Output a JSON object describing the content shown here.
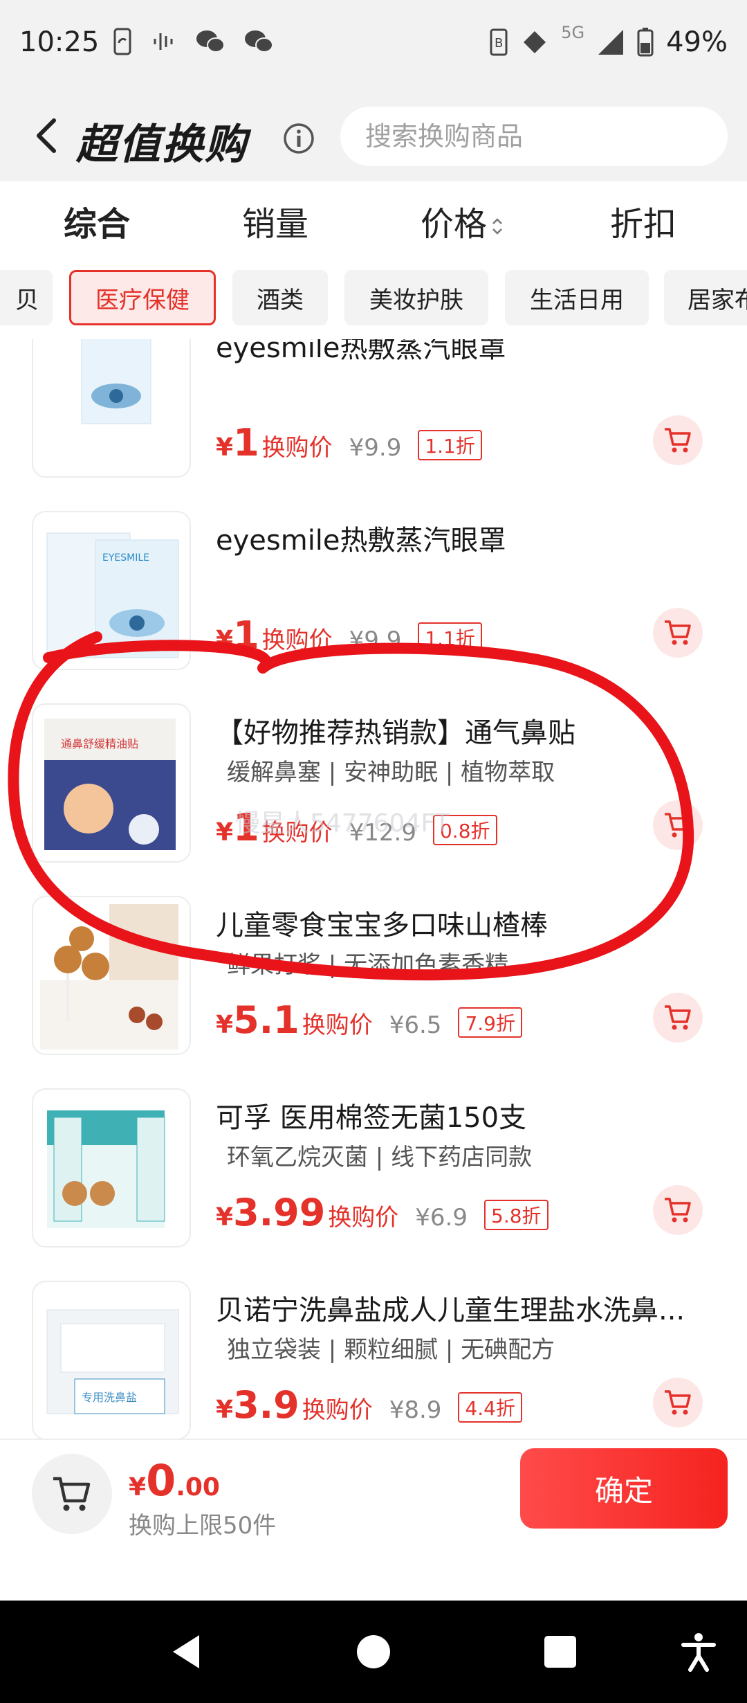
{
  "status_bar": {
    "time": "10:25",
    "network": "5G",
    "battery": "49%",
    "icons": [
      "phone-sync-icon",
      "voice-icon",
      "wechat-icon",
      "wechat-icon",
      "nfc-icon",
      "data-icon",
      "wifi-icon",
      "signal-icon",
      "battery-icon"
    ]
  },
  "header": {
    "title": "超值换购",
    "search_placeholder": "搜索换购商品"
  },
  "sort_tabs": [
    {
      "label": "综合",
      "active": true
    },
    {
      "label": "销量",
      "active": false
    },
    {
      "label": "价格",
      "active": false
    },
    {
      "label": "折扣",
      "active": false
    }
  ],
  "categories": [
    {
      "label": "贝",
      "active": false
    },
    {
      "label": "医疗保健",
      "active": true
    },
    {
      "label": "酒类",
      "active": false
    },
    {
      "label": "美妆护肤",
      "active": false
    },
    {
      "label": "生活日用",
      "active": false
    },
    {
      "label": "居家布",
      "active": false
    }
  ],
  "products": [
    {
      "title": "eyesmile热敷蒸汽眼罩",
      "tags": "",
      "price": "1",
      "price_label": "换购价",
      "original": "¥9.9",
      "discount": "1.1折"
    },
    {
      "title": "eyesmile热敷蒸汽眼罩",
      "tags": "",
      "price": "1",
      "price_label": "换购价",
      "original": "¥9.9",
      "discount": "1.1折"
    },
    {
      "title": "【好物推荐热销款】通气鼻贴",
      "tags": "缓解鼻塞 | 安神助眠 | 植物萃取",
      "price": "1",
      "price_label": "换购价",
      "original": "¥12.9",
      "discount": "0.8折"
    },
    {
      "title": "儿童零食宝宝多口味山楂棒",
      "tags": "鲜果打浆 | 无添加色素香精",
      "price": "5.1",
      "price_label": "换购价",
      "original": "¥6.5",
      "discount": "7.9折"
    },
    {
      "title": "可孚 医用棉签无菌150支",
      "tags": "环氧乙烷灭菌 | 线下药店同款",
      "price": "3.99",
      "price_label": "换购价",
      "original": "¥6.9",
      "discount": "5.8折"
    },
    {
      "title": "贝诺宁洗鼻盐成人儿童生理盐水洗鼻...",
      "tags": "独立袋装 | 颗粒细腻 | 无碘配方",
      "price": "3.9",
      "price_label": "换购价",
      "original": "¥8.9",
      "discount": "4.4折"
    }
  ],
  "currency": "¥",
  "watermark": "慢星人5477604FT",
  "bottom": {
    "yen": "¥",
    "total_int": "0",
    "total_dec": ".00",
    "limit": "换购上限50件",
    "confirm": "确定"
  },
  "colors": {
    "accent": "#e4322b",
    "background": "#f2f2f2",
    "annotation": "#e8141a"
  }
}
